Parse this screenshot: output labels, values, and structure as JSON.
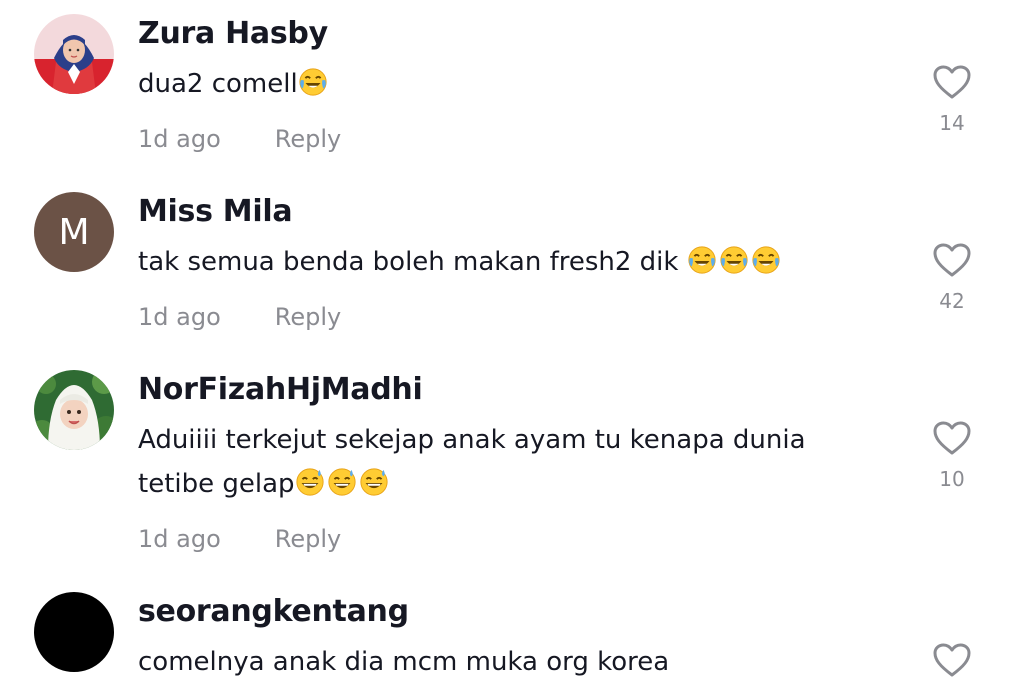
{
  "comments": [
    {
      "username": "Zura Hasby",
      "text": "dua2 comell",
      "emojis": [
        "joy"
      ],
      "time": "1d ago",
      "reply_label": "Reply",
      "likes": "14",
      "avatar": "photo-woman-hijab"
    },
    {
      "username": "Miss Mila",
      "text": "tak semua benda boleh makan fresh2 dik ",
      "emojis": [
        "joy",
        "joy",
        "joy"
      ],
      "time": "1d ago",
      "reply_label": "Reply",
      "likes": "42",
      "avatar_initial": "M",
      "avatar_color": "#6b5246"
    },
    {
      "username": "NorFizahHjMadhi",
      "text_line1": "Aduiiii terkejut sekejap anak ayam tu kenapa dunia",
      "text_line2": "tetibe gelap",
      "emojis": [
        "sweat-smile",
        "sweat-smile",
        "sweat-smile"
      ],
      "time": "1d ago",
      "reply_label": "Reply",
      "likes": "10",
      "avatar": "photo-baby-headscarf"
    },
    {
      "username": "seorangkentang",
      "text": "comelnya anak dia mcm muka org korea",
      "avatar_color": "#000000"
    }
  ],
  "colors": {
    "text": "#161823",
    "secondary": "#8a8b91",
    "heart_outline": "#8a8b91"
  }
}
